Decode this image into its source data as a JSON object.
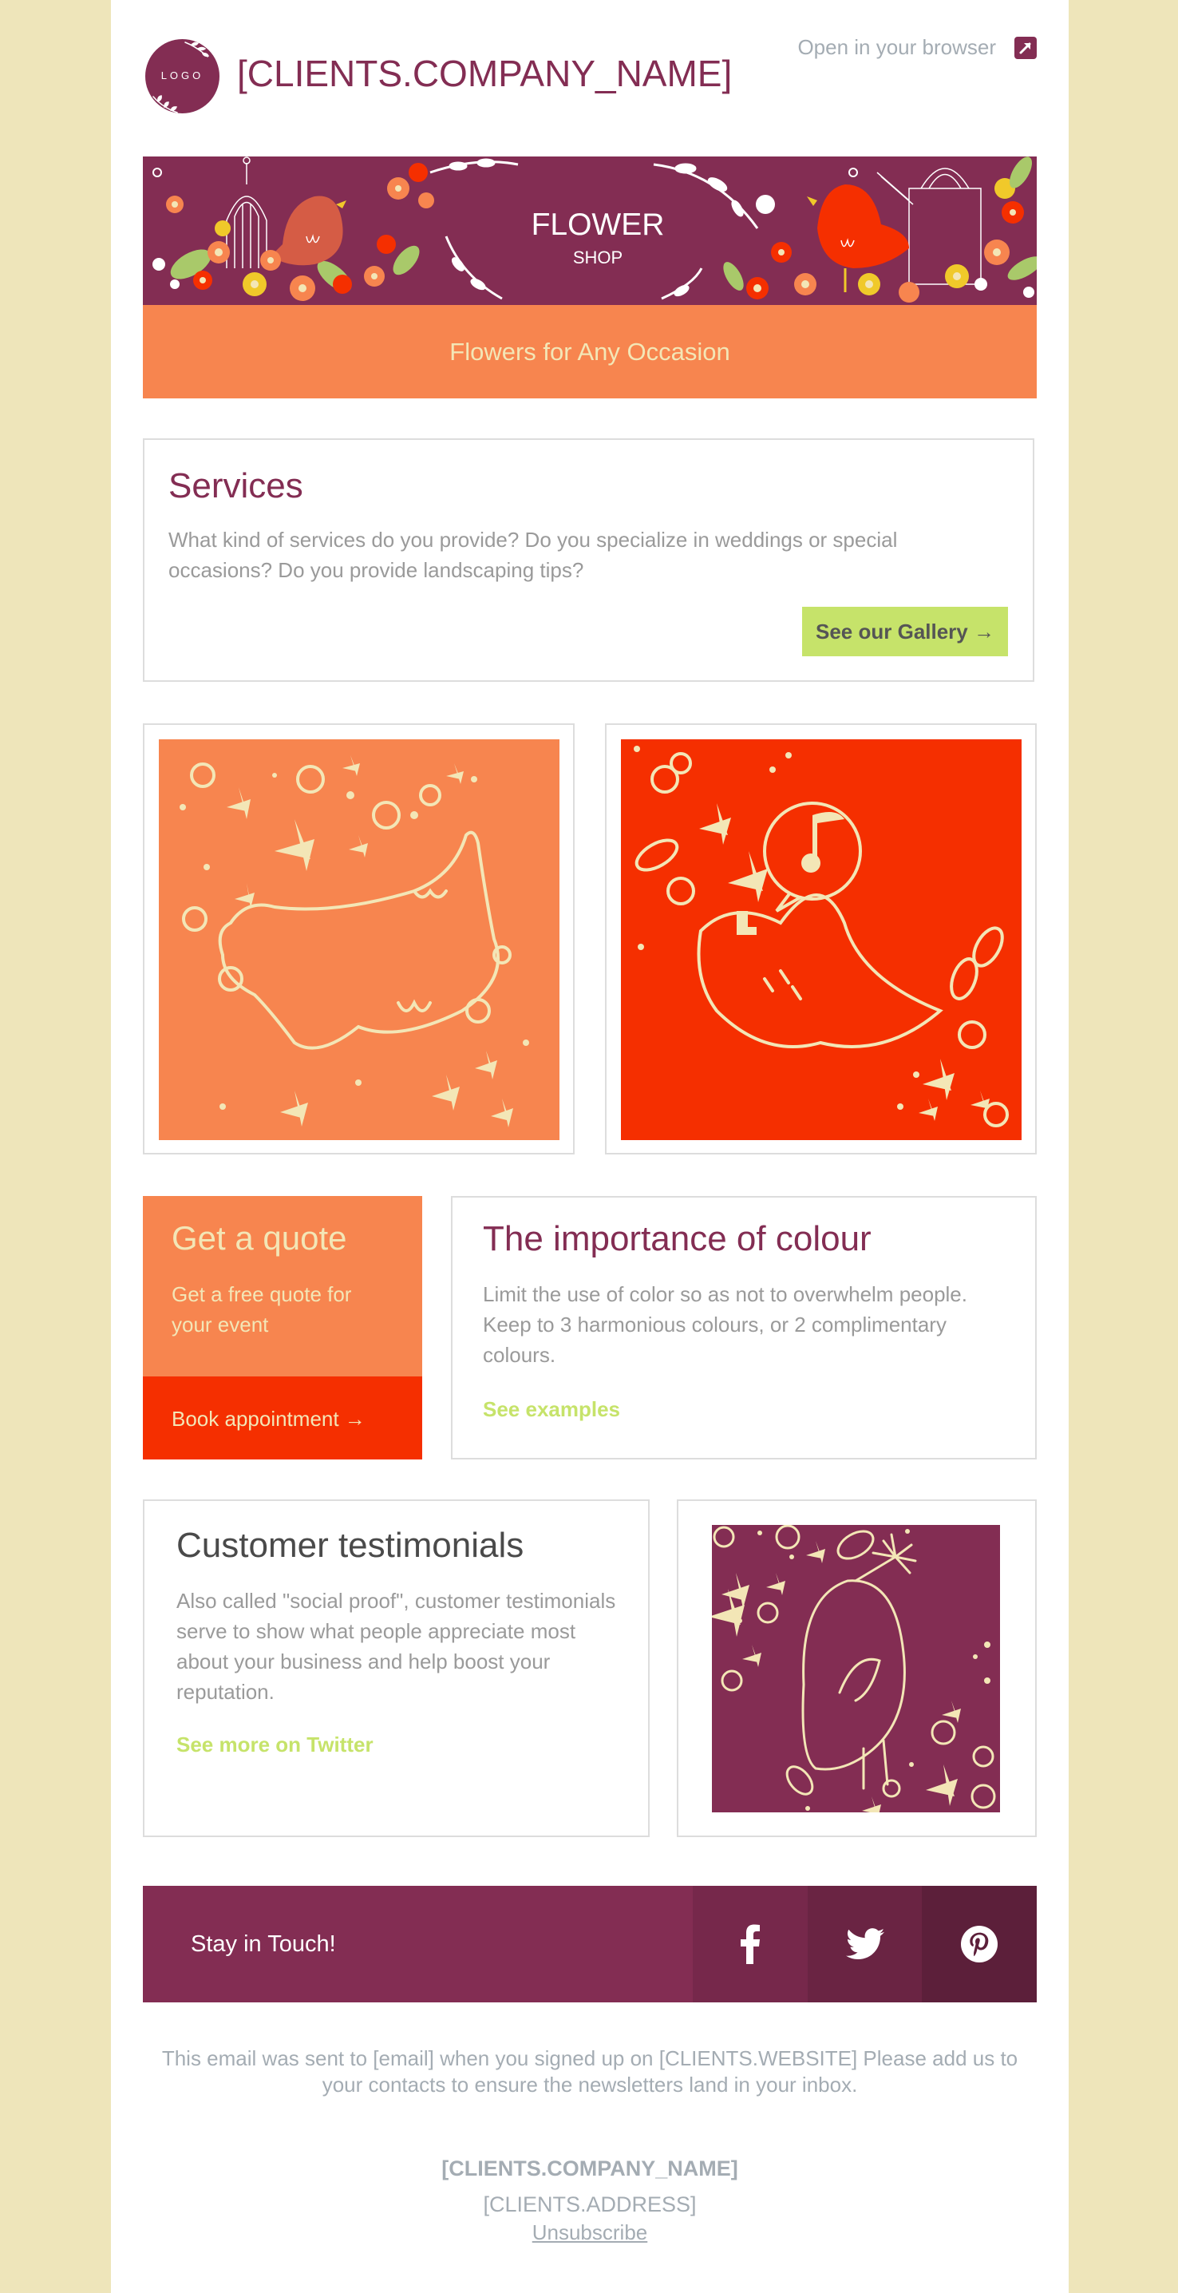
{
  "colors": {
    "page_bg": "#EEE5BA",
    "brand_purple": "#832D53",
    "accent_orange": "#F7854F",
    "accent_red": "#F52F00",
    "accent_green": "#C6E36A",
    "cream": "#F3E6B6",
    "muted_gray": "#A4ACB3"
  },
  "header": {
    "logo_text": "LOGO",
    "company_name": "[CLIENTS.COMPANY_NAME]",
    "open_in_browser": "Open in your browser",
    "open_icon": "external-link-icon"
  },
  "banner": {
    "title": "FLOWER",
    "subtitle": "SHOP",
    "tagline": "Flowers for Any Occasion"
  },
  "services": {
    "heading": "Services",
    "body": "What kind of services do you provide? Do you specialize in weddings or special occasions? Do you provide landscaping tips?",
    "button_label": "See our Gallery →"
  },
  "gallery": [
    {
      "alt": "Illustrated bird with flowers on orange background",
      "icon": "bird-illustration"
    },
    {
      "alt": "Illustrated singing bird with music note on red background",
      "icon": "singing-bird-illustration"
    }
  ],
  "quote": {
    "heading": "Get a quote",
    "body": "Get a free quote for your event",
    "button_label": "Book appointment →"
  },
  "colour_tip": {
    "heading": "The importance of colour",
    "body": "Limit the use of color so as not to overwhelm people. Keep to 3 harmonious colours, or 2 complimentary colours.",
    "link_label": "See examples"
  },
  "testimonials": {
    "heading": "Customer testimonials",
    "body": "Also called \"social proof\", customer testimonials serve to show what people appreciate most about your business and help boost your reputation.",
    "link_label": "See more on Twitter",
    "image_alt": "Illustrated bird holding a dandelion on purple background"
  },
  "social": {
    "label": "Stay in Touch!",
    "items": [
      {
        "name": "facebook",
        "icon": "facebook-icon"
      },
      {
        "name": "twitter",
        "icon": "twitter-icon"
      },
      {
        "name": "pinterest",
        "icon": "pinterest-icon"
      }
    ]
  },
  "footer": {
    "note": "This email was sent to [email] when you signed up on [CLIENTS.WEBSITE] Please add us to your contacts to ensure the newsletters land in your inbox.",
    "company_name": "[CLIENTS.COMPANY_NAME]",
    "address": "[CLIENTS.ADDRESS]",
    "unsubscribe": "Unsubscribe"
  }
}
